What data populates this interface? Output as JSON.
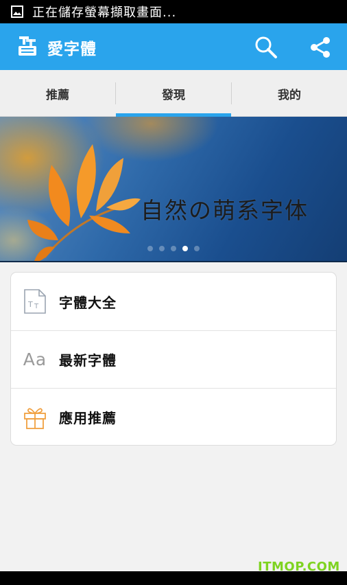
{
  "status_bar": {
    "text": "正在儲存螢幕擷取畫面..."
  },
  "app_bar": {
    "title": "愛字體",
    "logo_icon": "font-logo-icon",
    "actions": [
      "search-icon",
      "share-icon"
    ],
    "color": "#2aa4ec"
  },
  "tabs": {
    "items": [
      {
        "label": "推薦"
      },
      {
        "label": "發現"
      },
      {
        "label": "我的"
      }
    ],
    "active": "發現"
  },
  "banner": {
    "text": "自然の萌系字体",
    "slide_count": 5,
    "active_slide": 4
  },
  "menu": {
    "items": [
      {
        "label": "字體大全",
        "icon": "font-document-icon"
      },
      {
        "label": "最新字體",
        "icon": "aa-text-icon",
        "icon_text": "Aa"
      },
      {
        "label": "應用推薦",
        "icon": "gift-icon"
      }
    ]
  },
  "watermark": "ITMOP.COM"
}
